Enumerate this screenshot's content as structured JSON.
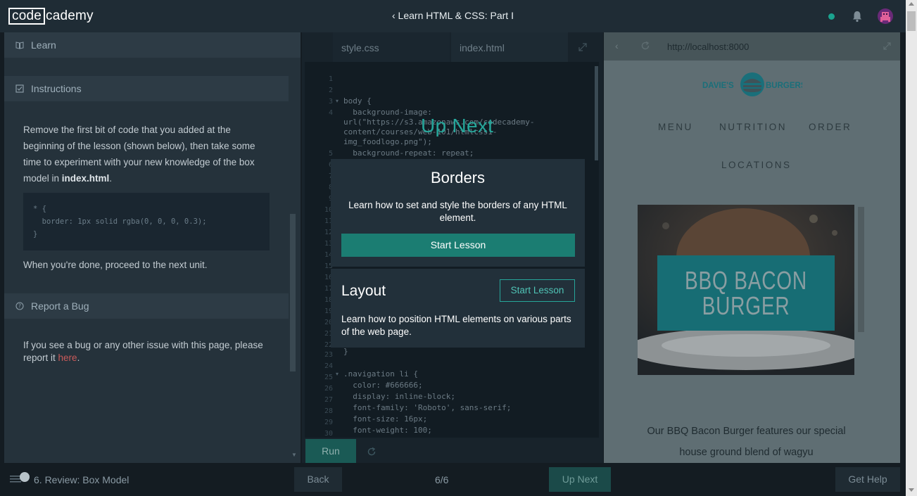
{
  "header": {
    "logo_part1": "code",
    "logo_part2": "cademy",
    "course_title": "‹ Learn HTML & CSS: Part I",
    "status_color": "#1aa38f",
    "icons": [
      "bell-icon",
      "avatar"
    ]
  },
  "left_panel": {
    "learn_label": "Learn",
    "instructions_label": "Instructions",
    "instructions_text_before": "Remove the first bit of code that you added at the beginning of the lesson (shown below), then take some time to experiment with your new knowledge of the box model in ",
    "instructions_filename": "index.html",
    "instructions_text_after": ".",
    "code_lines": [
      "* {",
      "  border: 1px solid rgba(0, 0, 0, 0.3);",
      "}"
    ],
    "done_text": "When you're done, proceed to the next unit.",
    "report_label": "Report a Bug",
    "bug_text": "If you see a bug or any other issue with this page, please report it ",
    "bug_link": "here",
    "bug_text_end": "."
  },
  "editor": {
    "tabs": [
      "style.css",
      "index.html"
    ],
    "line_numbers": [
      "1",
      "2",
      "3",
      "4",
      "",
      "",
      "",
      "5",
      "6",
      "7",
      "8",
      "9",
      "10",
      "11",
      "12",
      "13",
      "14",
      "15",
      "16",
      "17",
      "18",
      "19",
      "20",
      "21",
      "22",
      "23",
      "24",
      "25",
      "26",
      "27",
      "28",
      "29",
      "30"
    ],
    "visible_lines": [
      {
        "n": "3",
        "text": "body {"
      },
      {
        "n": "4",
        "text": "  background-image:"
      },
      {
        "n": "",
        "text": "url(\"https://s3.amazonaws.com/codecademy-"
      },
      {
        "n": "",
        "text": "content/courses/web-101/htmlcss1-"
      },
      {
        "n": "",
        "text": "img_foodlogo.png\");"
      },
      {
        "n": "5",
        "text": "  background-repeat: repeat;"
      },
      {
        "n": "23",
        "text": "}"
      },
      {
        "n": "25",
        "text": ".navigation li {"
      },
      {
        "n": "26",
        "text": "  color: #666666;"
      },
      {
        "n": "27",
        "text": "  display: inline-block;"
      },
      {
        "n": "28",
        "text": "  font-family: 'Roboto', sans-serif;"
      },
      {
        "n": "29",
        "text": "  font-size: 16px;"
      },
      {
        "n": "30",
        "text": "  font-weight: 100;"
      }
    ],
    "run_label": "Run"
  },
  "up_next": {
    "heading": "Up Next",
    "card1": {
      "title": "Borders",
      "description": "Learn how to set and style the borders of any HTML element.",
      "button": "Start Lesson"
    },
    "card2": {
      "title": "Layout",
      "description": "Learn how to position HTML elements on various parts of the web page.",
      "button": "Start Lesson"
    }
  },
  "preview": {
    "url": "http://localhost:8000",
    "site_name_left": "DAVIE'S",
    "site_name_right": "BURGERS",
    "nav": [
      "MENU",
      "NUTRITION",
      "ORDER",
      "LOCATIONS"
    ],
    "hero_line1": "BBQ BACON",
    "hero_line2": "BURGER",
    "description": "Our BBQ Bacon Burger features our special house ground blend of wagyu"
  },
  "footer": {
    "lesson_name": "6. Review: Box Model",
    "back_label": "Back",
    "progress": "6/6",
    "up_next_label": "Up Next",
    "help_label": "Get Help"
  }
}
